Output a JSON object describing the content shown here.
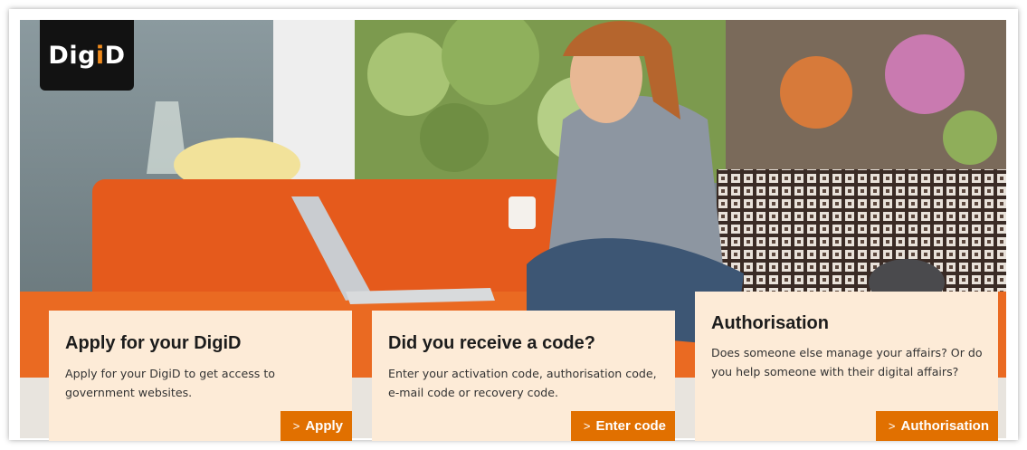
{
  "logo": {
    "text_main": "Dig",
    "text_i": "i",
    "text_d": "D"
  },
  "colors": {
    "accent": "#e17000",
    "card_bg": "#fdebd7",
    "logo_bg": "#121212",
    "sofa": "#e55a1c"
  },
  "cards": [
    {
      "title": "Apply for your DigiD",
      "text": "Apply for your DigiD to get access to government websites.",
      "button": "Apply",
      "button_icon": "chevron-right-icon"
    },
    {
      "title": "Did you receive a code?",
      "text": "Enter your activation code, authorisation code, e-mail code or recovery code.",
      "button": "Enter code",
      "button_icon": "chevron-right-icon"
    },
    {
      "title": "Authorisation",
      "text": "Does someone else manage your affairs? Or do you help someone with their digital affairs?",
      "button": "Authorisation",
      "button_icon": "chevron-right-icon"
    }
  ]
}
